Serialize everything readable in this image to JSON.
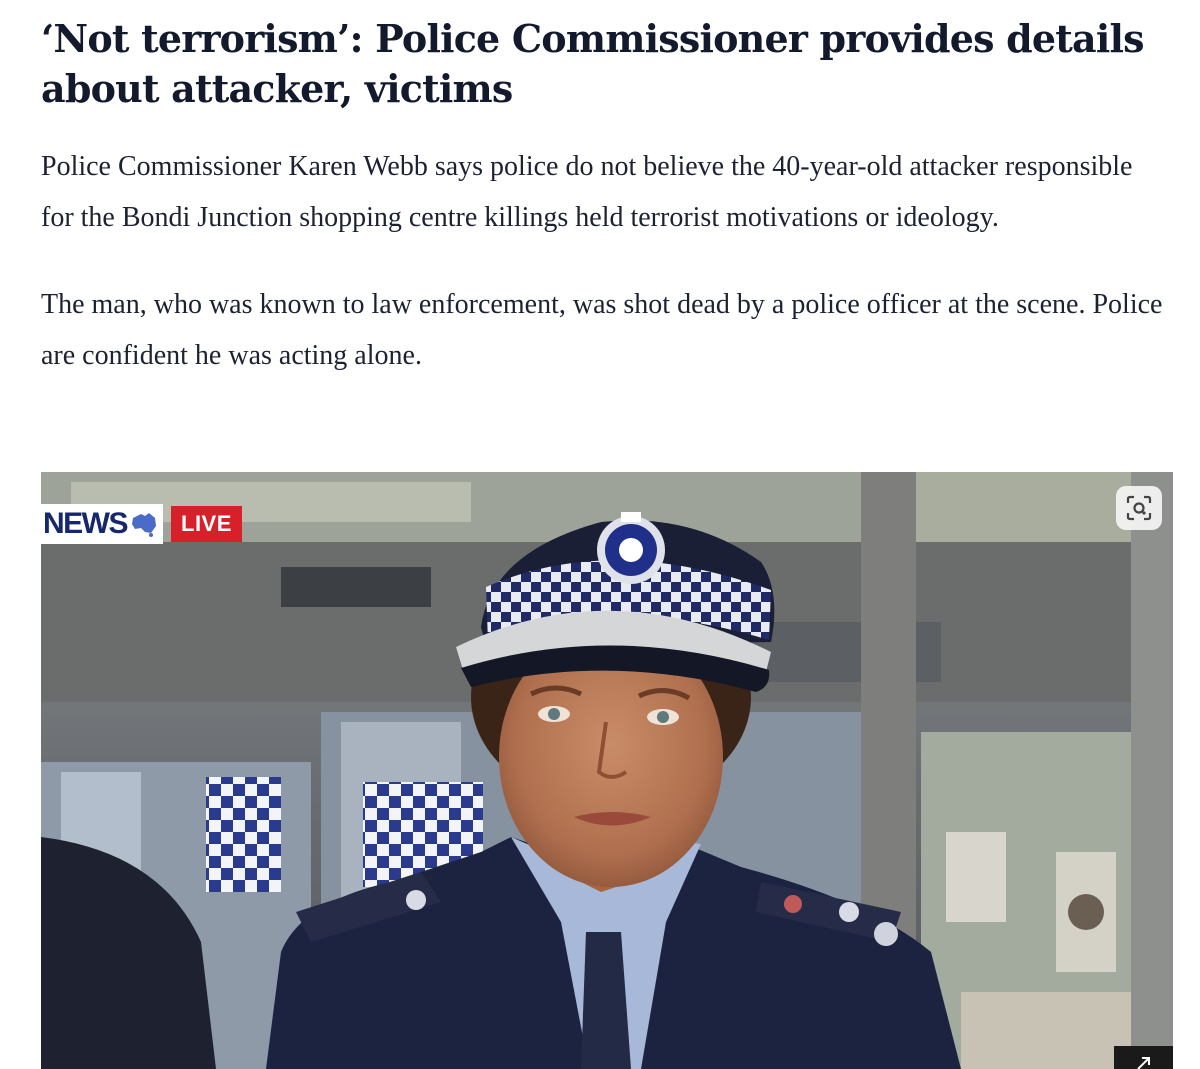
{
  "article": {
    "headline": "‘Not terrorism’: Police Commissioner provides details about attacker, victims",
    "paragraphs": [
      "Police Commissioner Karen Webb says police do not believe the 40-year-old attacker responsible for the Bondi Junction shopping centre killings held terrorist motivations or ideology.",
      "The man, who was known to law enforcement, was shot dead by a police officer at the scene. Police are confident he was acting alone."
    ]
  },
  "media": {
    "broadcast_logo_text": "NEWS",
    "live_badge": "LIVE",
    "icons": {
      "lens": "image-search-icon",
      "expand": "expand-arrow-icon",
      "logo": "australia-map-icon"
    },
    "colors": {
      "live_red": "#d8202a",
      "news_navy": "#14286b",
      "uniform_navy": "#1c2340"
    }
  }
}
